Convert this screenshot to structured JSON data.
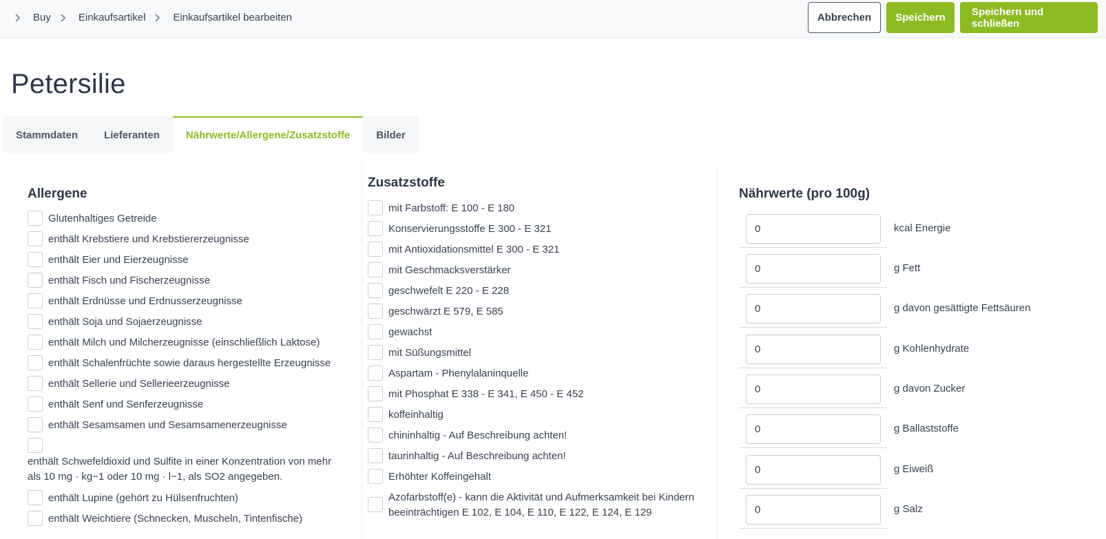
{
  "breadcrumb": [
    "Buy",
    "Einkaufsartikel",
    "Einkaufsartikel bearbeiten"
  ],
  "actions": {
    "cancel": "Abbrechen",
    "save": "Speichern",
    "save_close": "Speichern und schließen"
  },
  "title": "Petersilie",
  "tabs": [
    {
      "label": "Stammdaten",
      "active": false
    },
    {
      "label": "Lieferanten",
      "active": false
    },
    {
      "label": "Nährwerte/Allergene/Zusatzstoffe",
      "active": true
    },
    {
      "label": "Bilder",
      "active": false
    }
  ],
  "allergene": {
    "heading": "Allergene",
    "items": [
      "Glutenhaltiges Getreide",
      "enthält Krebstiere und Krebstiererzeugnisse",
      "enthält Eier und Eierzeugnisse",
      "enthält Fisch und Fischerzeugnisse",
      "enthält Erdnüsse und Erdnusserzeugnisse",
      "enthält Soja und Sojaerzeugnisse",
      "enthält Milch und Milcherzeugnisse (einschließlich Laktose)",
      "enthält Schalenfrüchte sowie daraus hergestellte Erzeugnisse",
      "enthält Sellerie und Sellerieerzeugnisse",
      "enthält Senf und Senferzeugnisse",
      "enthält Sesamsamen und Sesamsamenerzeugnisse",
      "enthält Schwefeldioxid und Sulfite in einer Konzentration von mehr als 10 mg · kg−1 oder 10 mg · l−1, als SO2 angegeben.",
      "enthält Lupine (gehört zu Hülsenfruchten)",
      "enthält Weichtiere (Schnecken, Muscheln, Tintenfische)"
    ]
  },
  "zusatzstoffe": {
    "heading": "Zusatzstoffe",
    "items": [
      "mit Farbstoff: E 100 - E 180",
      "Konservierungsstoffe E 300 - E 321",
      "mit Antioxidationsmittel E 300 - E 321",
      "mit Geschmacksverstärker",
      "geschwefelt E 220 - E 228",
      "geschwärzt E 579, E 585",
      "gewachst",
      "mit Süßungsmittel",
      "Aspartam - Phenylalaninquelle",
      "mit Phosphat E 338 - E 341, E 450 - E 452",
      "koffeinhaltig",
      "chininhaltig - Auf Beschreibung achten!",
      "taurinhaltig - Auf Beschreibung achten!",
      "Erhöhter Koffeingehalt",
      "Azofarbstoff(e) - kann die Aktivität und Aufmerksamkeit bei Kindern beeinträchtigen E 102, E 104, E 110, E 122, E 124, E 129"
    ]
  },
  "naehrwerte": {
    "heading": "Nährwerte (pro 100g)",
    "rows": [
      {
        "value": "0",
        "unit": "kcal Energie"
      },
      {
        "value": "0",
        "unit": "g Fett"
      },
      {
        "value": "0",
        "unit": "g davon gesättigte Fettsäuren"
      },
      {
        "value": "0",
        "unit": "g Kohlenhydrate"
      },
      {
        "value": "0",
        "unit": "g davon Zucker"
      },
      {
        "value": "0",
        "unit": "g Ballaststoffe"
      },
      {
        "value": "0",
        "unit": "g Eiweiß"
      },
      {
        "value": "0",
        "unit": "g Salz"
      }
    ]
  },
  "colors": {
    "accent": "#8cbb23",
    "text": "#374151",
    "heading": "#2d3748"
  }
}
